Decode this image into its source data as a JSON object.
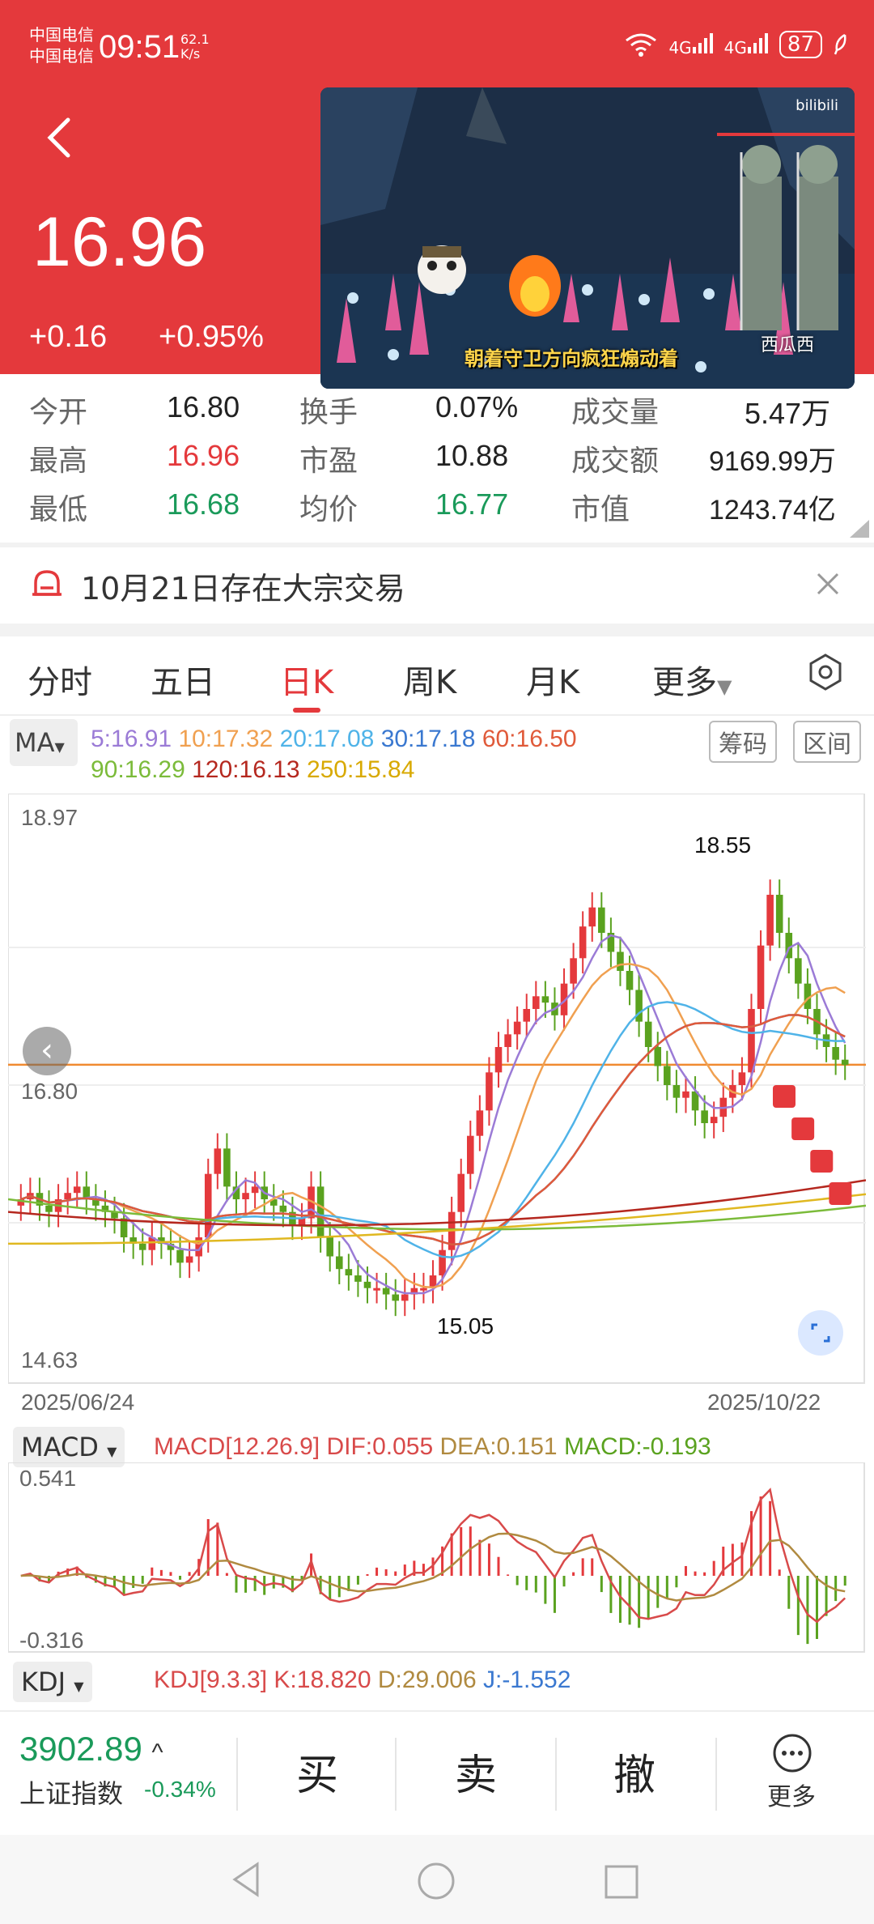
{
  "status_bar": {
    "carrier1": "中国电信",
    "carrier2": "中国电信",
    "time": "09:51",
    "net_speed_value": "62.1",
    "net_speed_unit": "K/s",
    "signal1": "4G",
    "signal2": "4G",
    "battery": "87"
  },
  "header": {
    "price": "16.96",
    "change": "+0.16",
    "change_pct": "+0.95%"
  },
  "video": {
    "caption": "朝着守卫方向疯狂煽动着",
    "name": "西瓜西",
    "watermark": "bilibili"
  },
  "quote": {
    "open_label": "今开",
    "open_value": "16.80",
    "turnover_label": "换手",
    "turnover_value": "0.07%",
    "volume_label": "成交量",
    "volume_value": "5.47万",
    "high_label": "最高",
    "high_value": "16.96",
    "pe_label": "市盈",
    "pe_value": "10.88",
    "amount_label": "成交额",
    "amount_value": "9169.99万",
    "low_label": "最低",
    "low_value": "16.68",
    "avg_label": "均价",
    "avg_value": "16.77",
    "mcap_label": "市值",
    "mcap_value": "1243.74亿"
  },
  "notice": {
    "text": "10月21日存在大宗交易"
  },
  "tabs": [
    "分时",
    "五日",
    "日K",
    "周K",
    "月K",
    "更多"
  ],
  "ma": {
    "selector": "MA",
    "ma5": "5:16.91",
    "ma10": "10:17.32",
    "ma20": "20:17.08",
    "ma30": "30:17.18",
    "ma60": "60:16.50",
    "ma90": "90:16.29",
    "ma120": "120:16.13",
    "ma250": "250:15.84",
    "chip_button": "筹码",
    "range_button": "区间",
    "colors": {
      "ma5": "#9b7bd6",
      "ma10": "#f0a050",
      "ma20": "#4fb3e8",
      "ma30": "#3a78d0",
      "ma60": "#e05a3a",
      "ma90": "#7bbb3a",
      "ma120": "#b5281f",
      "ma250": "#e0b820"
    }
  },
  "kchart": {
    "y_max": "18.97",
    "y_mid": "16.80",
    "y_min": "14.63",
    "high_mark": "18.55",
    "low_mark": "15.05",
    "date_start": "2025/06/24",
    "date_end": "2025/10/22"
  },
  "chart_data": {
    "type": "candlestick",
    "ylim": [
      14.63,
      18.97
    ],
    "x_range": [
      "2025/06/24",
      "2025/10/22"
    ],
    "annotations": {
      "max": 18.55,
      "min": 15.05
    },
    "closes": [
      15.9,
      15.95,
      15.85,
      15.8,
      15.9,
      15.95,
      16.0,
      15.9,
      15.85,
      15.8,
      15.75,
      15.6,
      15.55,
      15.5,
      15.6,
      15.55,
      15.5,
      15.4,
      15.45,
      15.6,
      16.1,
      16.3,
      16.0,
      15.9,
      15.95,
      16.0,
      15.9,
      15.85,
      15.8,
      15.7,
      15.75,
      16.0,
      15.6,
      15.45,
      15.35,
      15.3,
      15.25,
      15.2,
      15.2,
      15.15,
      15.1,
      15.15,
      15.2,
      15.2,
      15.3,
      15.5,
      15.8,
      16.1,
      16.4,
      16.6,
      16.9,
      17.1,
      17.2,
      17.3,
      17.4,
      17.5,
      17.45,
      17.35,
      17.6,
      17.8,
      18.05,
      18.2,
      18.0,
      17.85,
      17.7,
      17.55,
      17.3,
      17.1,
      16.95,
      16.8,
      16.7,
      16.75,
      16.6,
      16.5,
      16.55,
      16.7,
      16.8,
      16.9,
      17.4,
      17.9,
      18.3,
      18.0,
      17.8,
      17.6,
      17.4,
      17.2,
      17.1,
      17.0,
      16.96
    ],
    "macd": {
      "dif": 0.055,
      "dea": 0.151,
      "macd": -0.193,
      "ylim": [
        -0.316,
        0.541
      ]
    },
    "kdj": {
      "k": 18.82,
      "d": 29.006,
      "j": -1.552
    }
  },
  "macd": {
    "selector": "MACD",
    "params": "MACD[12.26.9]",
    "dif": "DIF:0.055",
    "dea": "DEA:0.151",
    "macd": "MACD:-0.193",
    "y_top": "0.541",
    "y_bottom": "-0.316"
  },
  "kdj": {
    "selector": "KDJ",
    "params": "KDJ[9.3.3]",
    "k": "K:18.820",
    "d": "D:29.006",
    "j": "J:-1.552"
  },
  "bottom": {
    "index_value": "3902.89",
    "index_name": "上证指数",
    "index_pct": "-0.34%",
    "buy": "买",
    "sell": "卖",
    "cancel": "撤",
    "more": "更多"
  }
}
